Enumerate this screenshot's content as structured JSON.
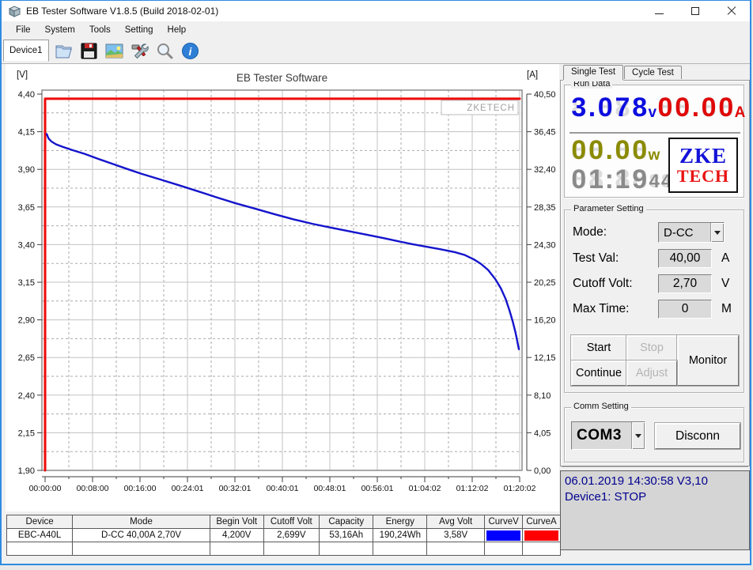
{
  "window": {
    "title": "EB Tester Software V1.8.5 (Build 2018-02-01)",
    "controls": [
      "minimize",
      "maximize",
      "close"
    ]
  },
  "menu": {
    "items": [
      "File",
      "System",
      "Tools",
      "Setting",
      "Help"
    ]
  },
  "toolbar": {
    "device_label": "Device1",
    "icons": [
      "open-file",
      "save",
      "image",
      "tools",
      "zoom",
      "info"
    ]
  },
  "chart_data": {
    "type": "line",
    "title": "EB Tester Software",
    "watermark": "ZKETECH",
    "left_axis": {
      "unit": "[V]",
      "min": 1.9,
      "max": 4.4,
      "ticks": [
        "4,40",
        "4,15",
        "3,90",
        "3,65",
        "3,40",
        "3,15",
        "2,90",
        "2,65",
        "2,40",
        "2,15",
        "1,90"
      ]
    },
    "right_axis": {
      "unit": "[A]",
      "min": 0,
      "max": 40.5,
      "ticks": [
        "40,50",
        "36,45",
        "32,40",
        "28,35",
        "24,30",
        "20,25",
        "16,20",
        "12,15",
        "8,10",
        "4,05",
        "0,00"
      ]
    },
    "x_axis": {
      "ticks": [
        "00:00:00",
        "00:08:00",
        "00:16:00",
        "00:24:01",
        "00:32:01",
        "00:40:01",
        "00:48:01",
        "00:56:01",
        "01:04:02",
        "01:12:02",
        "01:20:02"
      ]
    },
    "series": [
      {
        "name": "Voltage",
        "axis": "left",
        "color": "#1414cc",
        "points": [
          [
            0.0,
            4.135
          ],
          [
            0.004,
            4.105
          ],
          [
            0.01,
            4.085
          ],
          [
            0.02,
            4.066
          ],
          [
            0.035,
            4.048
          ],
          [
            0.055,
            4.027
          ],
          [
            0.08,
            4.003
          ],
          [
            0.11,
            3.968
          ],
          [
            0.14,
            3.935
          ],
          [
            0.17,
            3.902
          ],
          [
            0.2,
            3.87
          ],
          [
            0.24,
            3.832
          ],
          [
            0.28,
            3.793
          ],
          [
            0.32,
            3.753
          ],
          [
            0.36,
            3.712
          ],
          [
            0.4,
            3.673
          ],
          [
            0.44,
            3.638
          ],
          [
            0.48,
            3.602
          ],
          [
            0.52,
            3.568
          ],
          [
            0.56,
            3.538
          ],
          [
            0.6,
            3.512
          ],
          [
            0.64,
            3.487
          ],
          [
            0.68,
            3.462
          ],
          [
            0.71,
            3.443
          ],
          [
            0.74,
            3.423
          ],
          [
            0.77,
            3.403
          ],
          [
            0.8,
            3.386
          ],
          [
            0.83,
            3.369
          ],
          [
            0.86,
            3.35
          ],
          [
            0.88,
            3.332
          ],
          [
            0.9,
            3.302
          ],
          [
            0.915,
            3.272
          ],
          [
            0.93,
            3.232
          ],
          [
            0.945,
            3.172
          ],
          [
            0.957,
            3.11
          ],
          [
            0.967,
            3.04
          ],
          [
            0.975,
            2.965
          ],
          [
            0.982,
            2.89
          ],
          [
            0.988,
            2.815
          ],
          [
            0.992,
            2.752
          ],
          [
            0.995,
            2.705
          ]
        ]
      },
      {
        "name": "Current",
        "axis": "right",
        "color": "#ee0a0a",
        "points": [
          [
            0.0,
            0.0
          ],
          [
            0.0,
            40.0
          ],
          [
            1.0,
            40.0
          ]
        ]
      }
    ]
  },
  "right_panel": {
    "tabs": [
      {
        "label": "Single Test"
      },
      {
        "label": "Cycle Test"
      }
    ],
    "run_data": {
      "legend": "Run Data",
      "voltage": {
        "value": "3.078",
        "unit": "v"
      },
      "current": {
        "value": "00.00",
        "unit": "A"
      },
      "power": {
        "value": "00.00",
        "unit": "w"
      },
      "time": {
        "main": "01:19",
        "secs": "44"
      },
      "logo": {
        "line1": "ZKE",
        "line2": "TECH"
      }
    },
    "parameter_setting": {
      "legend": "Parameter Setting",
      "mode": {
        "label": "Mode:",
        "value": "D-CC"
      },
      "test_val": {
        "label": "Test Val:",
        "value": "40,00",
        "unit": "A"
      },
      "cutoff_volt": {
        "label": "Cutoff Volt:",
        "value": "2,70",
        "unit": "V"
      },
      "max_time": {
        "label": "Max Time:",
        "value": "0",
        "unit": "M"
      },
      "buttons": {
        "start": "Start",
        "stop": "Stop",
        "continue": "Continue",
        "adjust": "Adjust",
        "monitor": "Monitor"
      }
    },
    "comm_setting": {
      "legend": "Comm Setting",
      "port": "COM3",
      "disconnect": "Disconn"
    },
    "status": {
      "line1": "06.01.2019 14:30:58  V3,10",
      "line2": "Device1: STOP"
    }
  },
  "results_table": {
    "headers": [
      "Device",
      "Mode",
      "Begin Volt",
      "Cutoff Volt",
      "Capacity",
      "Energy",
      "Avg Volt",
      "CurveV",
      "CurveA"
    ],
    "row": {
      "device": "EBC-A40L",
      "mode": "D-CC  40,00A  2,70V",
      "begin_volt": "4,200V",
      "cutoff_volt": "2,699V",
      "capacity": "53,16Ah",
      "energy": "190,24Wh",
      "avg_volt": "3,58V",
      "curve_v_color": "#0000ff",
      "curve_a_color": "#ff0000"
    }
  }
}
